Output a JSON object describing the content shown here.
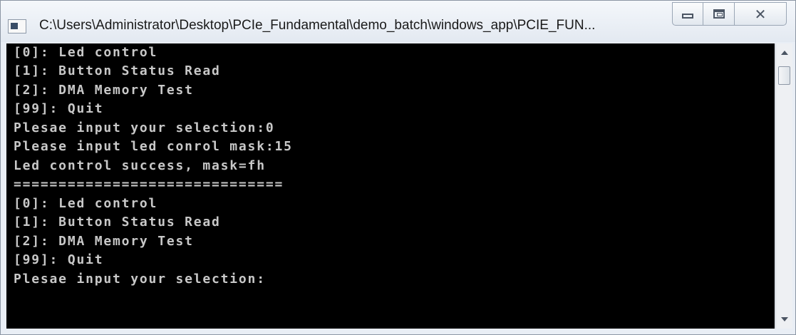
{
  "window": {
    "title": "C:\\Users\\Administrator\\Desktop\\PCIe_Fundamental\\demo_batch\\windows_app\\PCIE_FUN...",
    "icon": "console-app-icon",
    "buttons": {
      "minimize": "minimize-icon",
      "maximize": "maximize-icon",
      "close": "close-icon"
    }
  },
  "console": {
    "text_color": "#c8c8c8",
    "background": "#000000",
    "lines": [
      "[0]: Led control",
      "[1]: Button Status Read",
      "[2]: DMA Memory Test",
      "[99]: Quit",
      "Plesae input your selection:0",
      "Please input led conrol mask:15",
      "Led control success, mask=fh",
      "==============================",
      "[0]: Led control",
      "[1]: Button Status Read",
      "[2]: DMA Memory Test",
      "[99]: Quit",
      "Plesae input your selection:"
    ]
  },
  "scrollbar": {
    "up": "scroll-up-arrow-icon",
    "down": "scroll-down-arrow-icon"
  }
}
